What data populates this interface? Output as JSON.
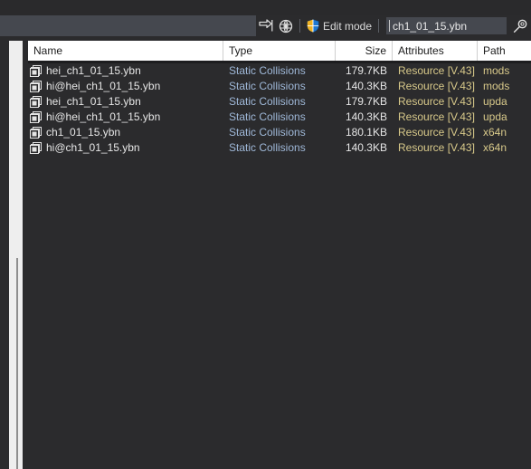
{
  "toolbar": {
    "enter_icon": "arrow-into-bracket-icon",
    "globe_icon": "globe-refresh-icon",
    "shield_icon": "uac-shield-icon",
    "edit_mode_label": "Edit mode",
    "search_value": "ch1_01_15.ybn",
    "search_icon": "magnifier-icon",
    "dropdown_marker": "▾"
  },
  "filelist": {
    "columns": [
      {
        "label": "Name",
        "align": "left"
      },
      {
        "label": "Type",
        "align": "left"
      },
      {
        "label": "Size",
        "align": "right"
      },
      {
        "label": "Attributes",
        "align": "left"
      },
      {
        "label": "Path",
        "align": "left"
      }
    ],
    "rows": [
      {
        "icon": "collision-bundle-icon",
        "name": "hei_ch1_01_15.ybn",
        "type": "Static Collisions",
        "size": "179.7KB",
        "attributes": "Resource [V.43]",
        "path": "mods"
      },
      {
        "icon": "collision-bundle-icon",
        "name": "hi@hei_ch1_01_15.ybn",
        "type": "Static Collisions",
        "size": "140.3KB",
        "attributes": "Resource [V.43]",
        "path": "mods"
      },
      {
        "icon": "collision-bundle-icon",
        "name": "hei_ch1_01_15.ybn",
        "type": "Static Collisions",
        "size": "179.7KB",
        "attributes": "Resource [V.43]",
        "path": "upda"
      },
      {
        "icon": "collision-bundle-icon",
        "name": "hi@hei_ch1_01_15.ybn",
        "type": "Static Collisions",
        "size": "140.3KB",
        "attributes": "Resource [V.43]",
        "path": "upda"
      },
      {
        "icon": "collision-bundle-icon",
        "name": "ch1_01_15.ybn",
        "type": "Static Collisions",
        "size": "180.1KB",
        "attributes": "Resource [V.43]",
        "path": "x64n"
      },
      {
        "icon": "collision-bundle-icon",
        "name": "hi@ch1_01_15.ybn",
        "type": "Static Collisions",
        "size": "140.3KB",
        "attributes": "Resource [V.43]",
        "path": "x64n"
      }
    ]
  },
  "colors": {
    "background": "#2b2b2d",
    "toolbar": "#45484f",
    "header_bg": "#ffffff",
    "type_text": "#9fb8d8",
    "attr_text": "#d8c98a",
    "name_text": "#e6e6e6",
    "panel_strip": "#eeeeee"
  }
}
